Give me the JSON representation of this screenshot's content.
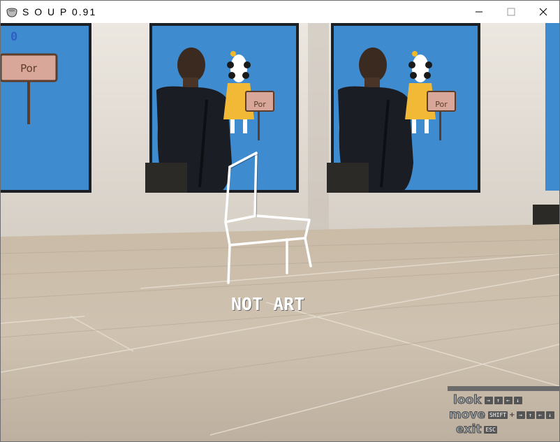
{
  "window": {
    "title": "S O U P 0.91",
    "icon": "soup-bowl-icon",
    "controls": {
      "minimize": "minimize-icon",
      "maximize": "maximize-icon",
      "close": "close-icon"
    }
  },
  "hud": {
    "score": "0",
    "object_label": "NOT ART"
  },
  "painting": {
    "sign_text": "Por"
  },
  "help": {
    "look": {
      "label": "look",
      "keys": [
        "→",
        "↑",
        "←",
        "↓"
      ]
    },
    "move": {
      "label": "move",
      "modifier": "SHIFT",
      "plus": "+",
      "keys": [
        "→",
        "↑",
        "←",
        "↓"
      ]
    },
    "exit": {
      "label": "exit",
      "key": "ESC"
    }
  },
  "colors": {
    "score": "#2e5fc4",
    "painting_sky": "#3f8bd0",
    "wall": "#e4ded6",
    "floor": "#c8bba9"
  }
}
